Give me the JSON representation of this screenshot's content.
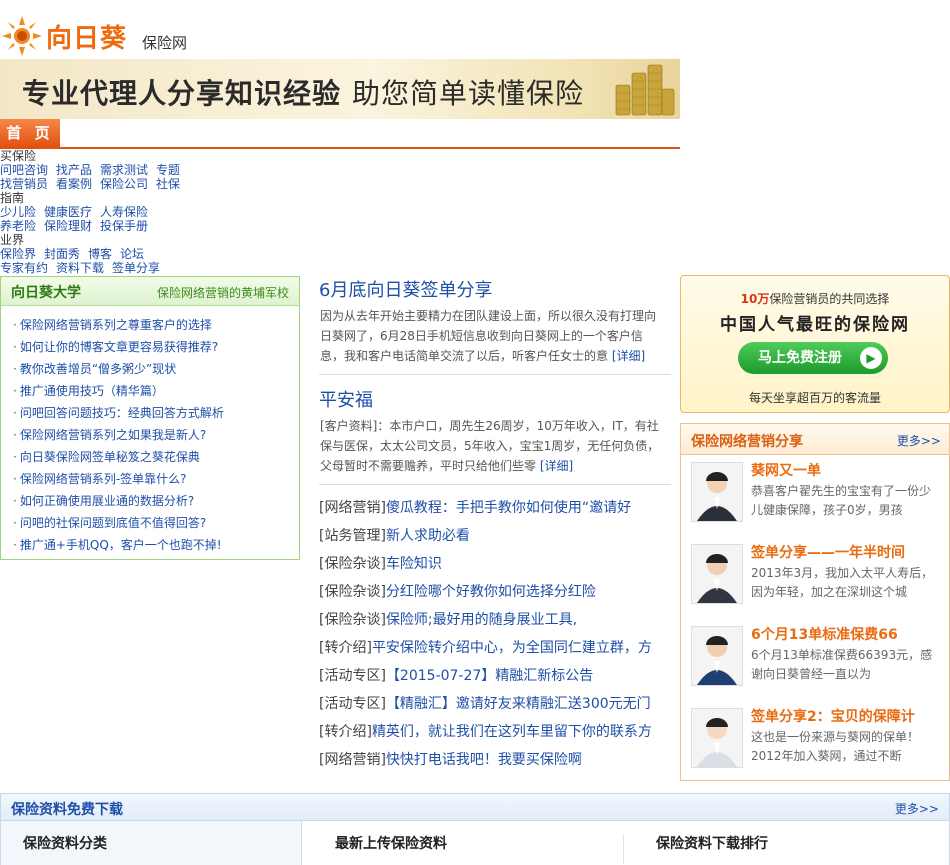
{
  "header": {
    "brand": "向日葵",
    "sub": "保险网",
    "banner_bold": "专业代理人分享知识经验",
    "banner_rest": "助您简单读懂保险",
    "home_tab": "首 页"
  },
  "nav": {
    "sections": [
      {
        "heading": "买保险",
        "rows": [
          [
            "问吧咨询",
            "找产品",
            "需求测试",
            "专题"
          ],
          [
            "找营销员",
            "看案例",
            "保险公司",
            "社保"
          ]
        ]
      },
      {
        "heading": "指南",
        "rows": [
          [
            "少儿险",
            "健康医疗",
            "人寿保险"
          ],
          [
            "养老险",
            "保险理财",
            "投保手册"
          ]
        ]
      },
      {
        "heading": "业界",
        "rows": [
          [
            "保险界",
            "封面秀",
            "博客",
            "论坛"
          ],
          [
            "专家有约",
            "资料下载",
            "签单分享"
          ]
        ]
      }
    ]
  },
  "university": {
    "title": "向日葵大学",
    "subtitle": "保险网络营销的黄埔军校",
    "items": [
      "保险网络营销系列之尊重客户的选择",
      "如何让你的博客文章更容易获得推荐?",
      "教你改善增员“僧多粥少”现状",
      "推广通使用技巧（精华篇）",
      "问吧回答问题技巧：经典回答方式解析",
      "保险网络营销系列之如果我是新人?",
      "向日葵保险网签单秘笈之葵花保典",
      "保险网络营销系列-签单靠什么?",
      "如何正确使用展业通的数据分析?",
      "问吧的社保问题到底值不值得回答?",
      "推广通+手机QQ，客户一个也跑不掉!"
    ]
  },
  "middle": {
    "article1": {
      "title": "6月底向日葵签单分享",
      "desc": "因为从去年开始主要精力在团队建设上面，所以很久没有打理向日葵网了，6月28日手机短信息收到向日葵网上的一个客户信息，我和客户电话简单交流了以后，听客户任女士的意",
      "more": "[详细]"
    },
    "article2": {
      "title": "平安福",
      "desc": "[客户资料]：本市户口，周先生26周岁，10万年收入，IT，有社保与医保，太太公司文员，5年收入，宝宝1周岁，无任何负债，父母暂时不需要赡养，平时只给他们些零",
      "more": "[详细]"
    },
    "list": [
      {
        "tag": "[网络营销]",
        "text": "傻瓜教程：手把手教你如何使用“邀请好"
      },
      {
        "tag": "[站务管理]",
        "text": "新人求助必看"
      },
      {
        "tag": "[保险杂谈]",
        "text": "车险知识"
      },
      {
        "tag": "[保险杂谈]",
        "text": "分红险哪个好教你如何选择分红险"
      },
      {
        "tag": "[保险杂谈]",
        "text": "保险师;最好用的随身展业工具,"
      },
      {
        "tag": "[转介绍]",
        "text": "平安保险转介绍中心，为全国同仁建立群，方"
      },
      {
        "tag": "[活动专区]",
        "text": "【2015-07-27】精融汇新标公告"
      },
      {
        "tag": "[活动专区]",
        "text": "【精融汇】邀请好友来精融汇送300元无门"
      },
      {
        "tag": "[转介绍]",
        "text": "精英们，就让我们在这列车里留下你的联系方"
      },
      {
        "tag": "[网络营销]",
        "text": "快快打电话我吧！我要买保险啊"
      }
    ]
  },
  "register": {
    "count": "10万",
    "line1_rest": "保险营销员的共同选择",
    "line2": "中国人气最旺的保险网",
    "button": "马上免费注册",
    "line3": "每天坐享超百万的客流量"
  },
  "share": {
    "title": "保险网络营销分享",
    "more": "更多>>",
    "items": [
      {
        "title": "葵网又一单",
        "desc": "恭喜客户翟先生的宝宝有了一份少儿健康保障，孩子0岁，男孩"
      },
      {
        "title": "签单分享——一年半时间",
        "desc": "2013年3月，我加入太平人寿后，因为年轻，加之在深圳这个城"
      },
      {
        "title": "6个月13单标准保费66",
        "desc": "6个月13单标准保费66393元，感谢向日葵曾经一直以为"
      },
      {
        "title": "签单分享2：宝贝的保障计",
        "desc": "这也是一份来源与葵网的保单！2012年加入葵网，通过不断"
      }
    ]
  },
  "download": {
    "title": "保险资料免费下载",
    "more": "更多>>",
    "col1": "保险资料分类",
    "col2": "最新上传保险资料",
    "col3": "保险资料下载排行"
  },
  "colors": {
    "accent": "#ef6b0c",
    "link": "#1f4fa8",
    "green": "#2f7a16"
  }
}
